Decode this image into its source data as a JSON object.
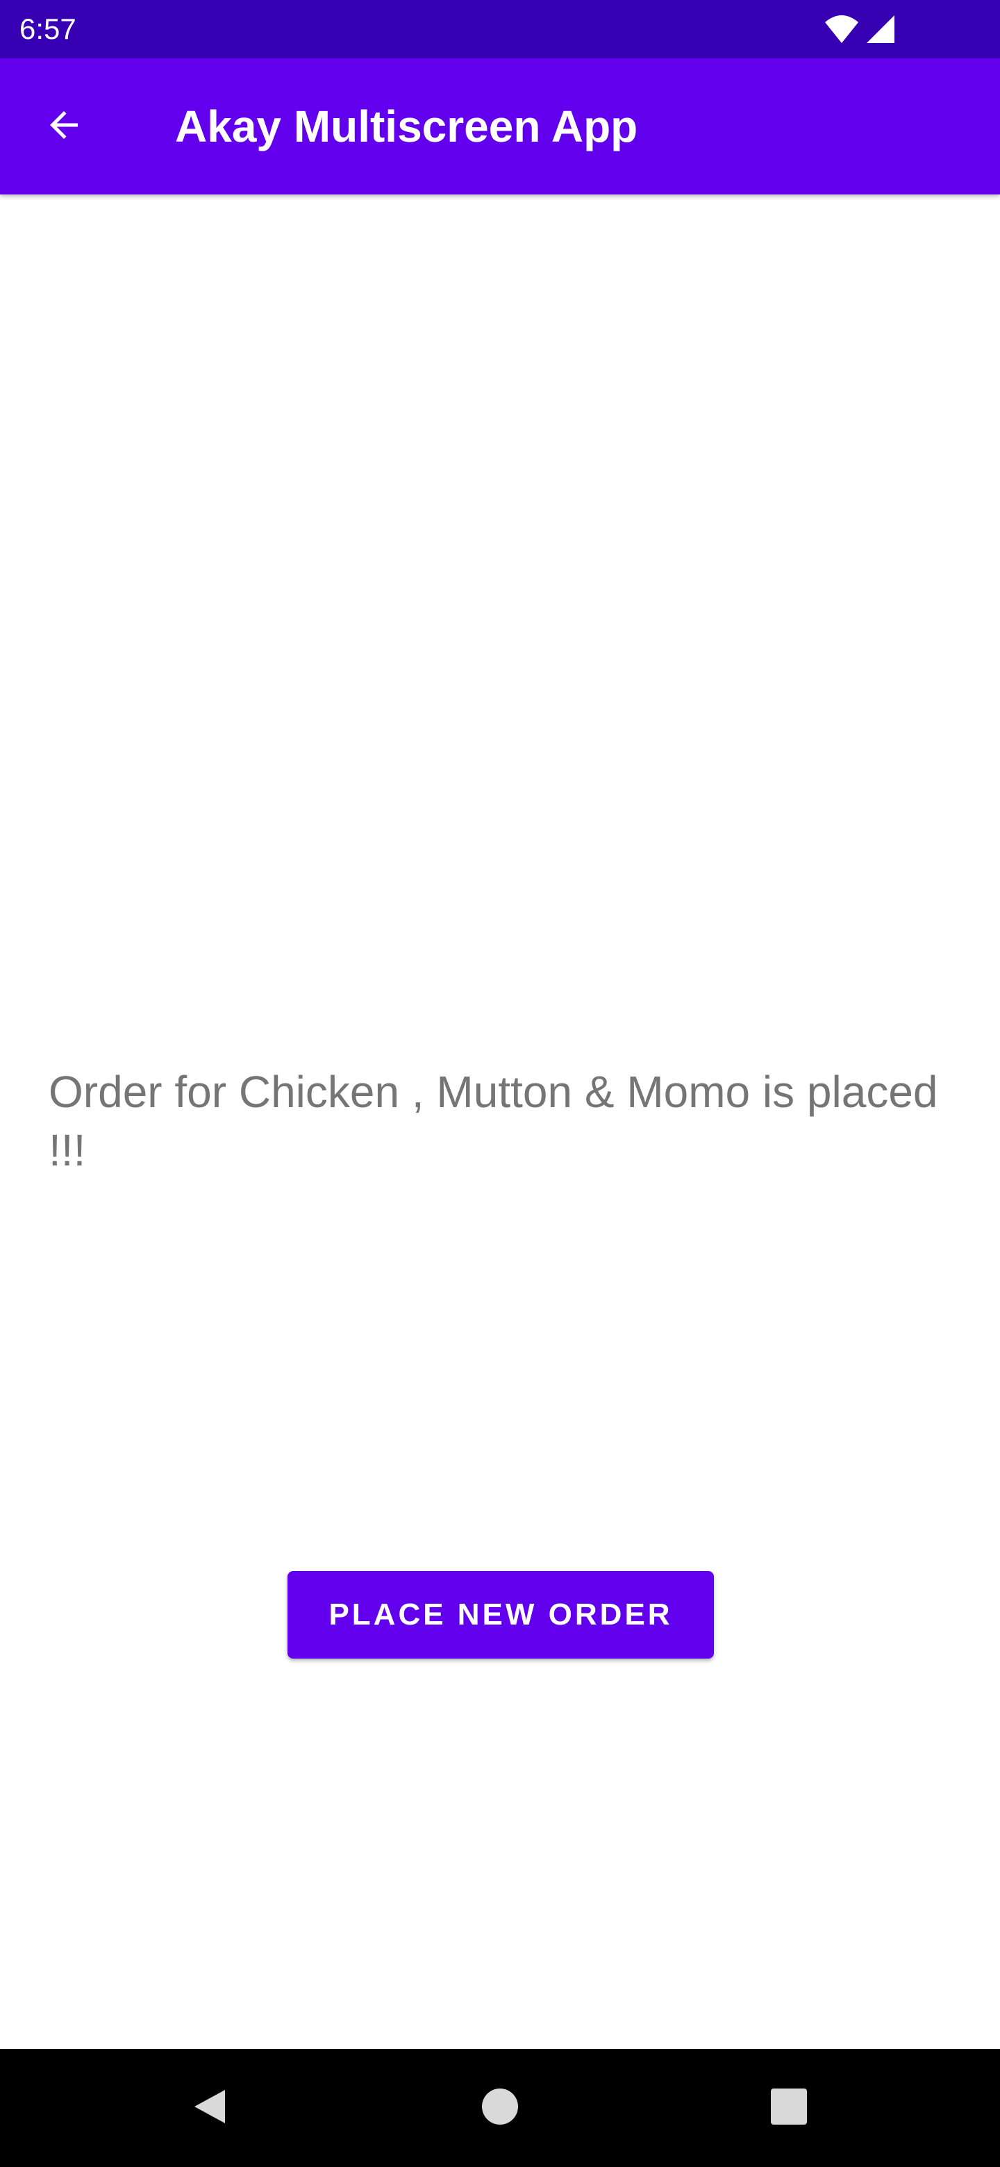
{
  "status_bar": {
    "time": "6:57",
    "icons": [
      "wifi-icon",
      "cellular-signal-icon"
    ]
  },
  "app_bar": {
    "title": "Akay Multiscreen App",
    "back_icon": "arrow-back-icon",
    "color": "#6200ee"
  },
  "main": {
    "message": "Order for Chicken , Mutton  & Momo is placed !!!"
  },
  "actions": {
    "place_order_label": "PLACE NEW ORDER"
  },
  "nav_bar": {
    "icons": [
      "nav-back-icon",
      "nav-home-icon",
      "nav-recents-icon"
    ]
  },
  "colors": {
    "status_bar": "#3700b3",
    "primary": "#6200ee",
    "message_text": "#757575"
  }
}
